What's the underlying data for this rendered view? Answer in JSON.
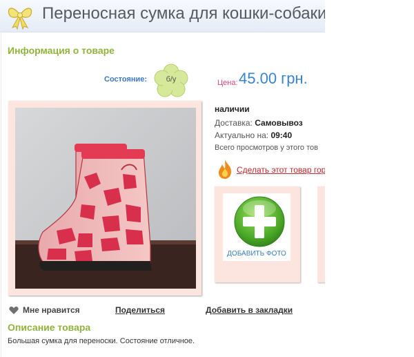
{
  "header": {
    "title": "Переносная сумка для кошки-собаки"
  },
  "info": {
    "section_title": "Информация о товаре",
    "condition_label": "Состояние:",
    "condition_value": "б/у",
    "price_label": "Цена:",
    "price_value": "45.00 грн.",
    "availability": "наличии",
    "delivery_label": "Доставка:",
    "delivery_value": "Самовывоз",
    "actual_label": "Актуально на:",
    "actual_value": "09:40",
    "views_text": "Всего просмотров у этого тов",
    "hot_link": "Сделать этот товар гор"
  },
  "photos": {
    "add_label": "ДОБАВИТЬ ФОТО"
  },
  "actions": {
    "like": "Мне нравится",
    "share": "Поделиться",
    "bookmark": "Добавить в закладки"
  },
  "description": {
    "title": "Описание товара",
    "text": "Большая сумка для переноски. Состояние отличное."
  },
  "colors": {
    "accent_green": "#8fb43d",
    "price_blue": "#3a83d0",
    "card_pink": "#fbe5de"
  }
}
